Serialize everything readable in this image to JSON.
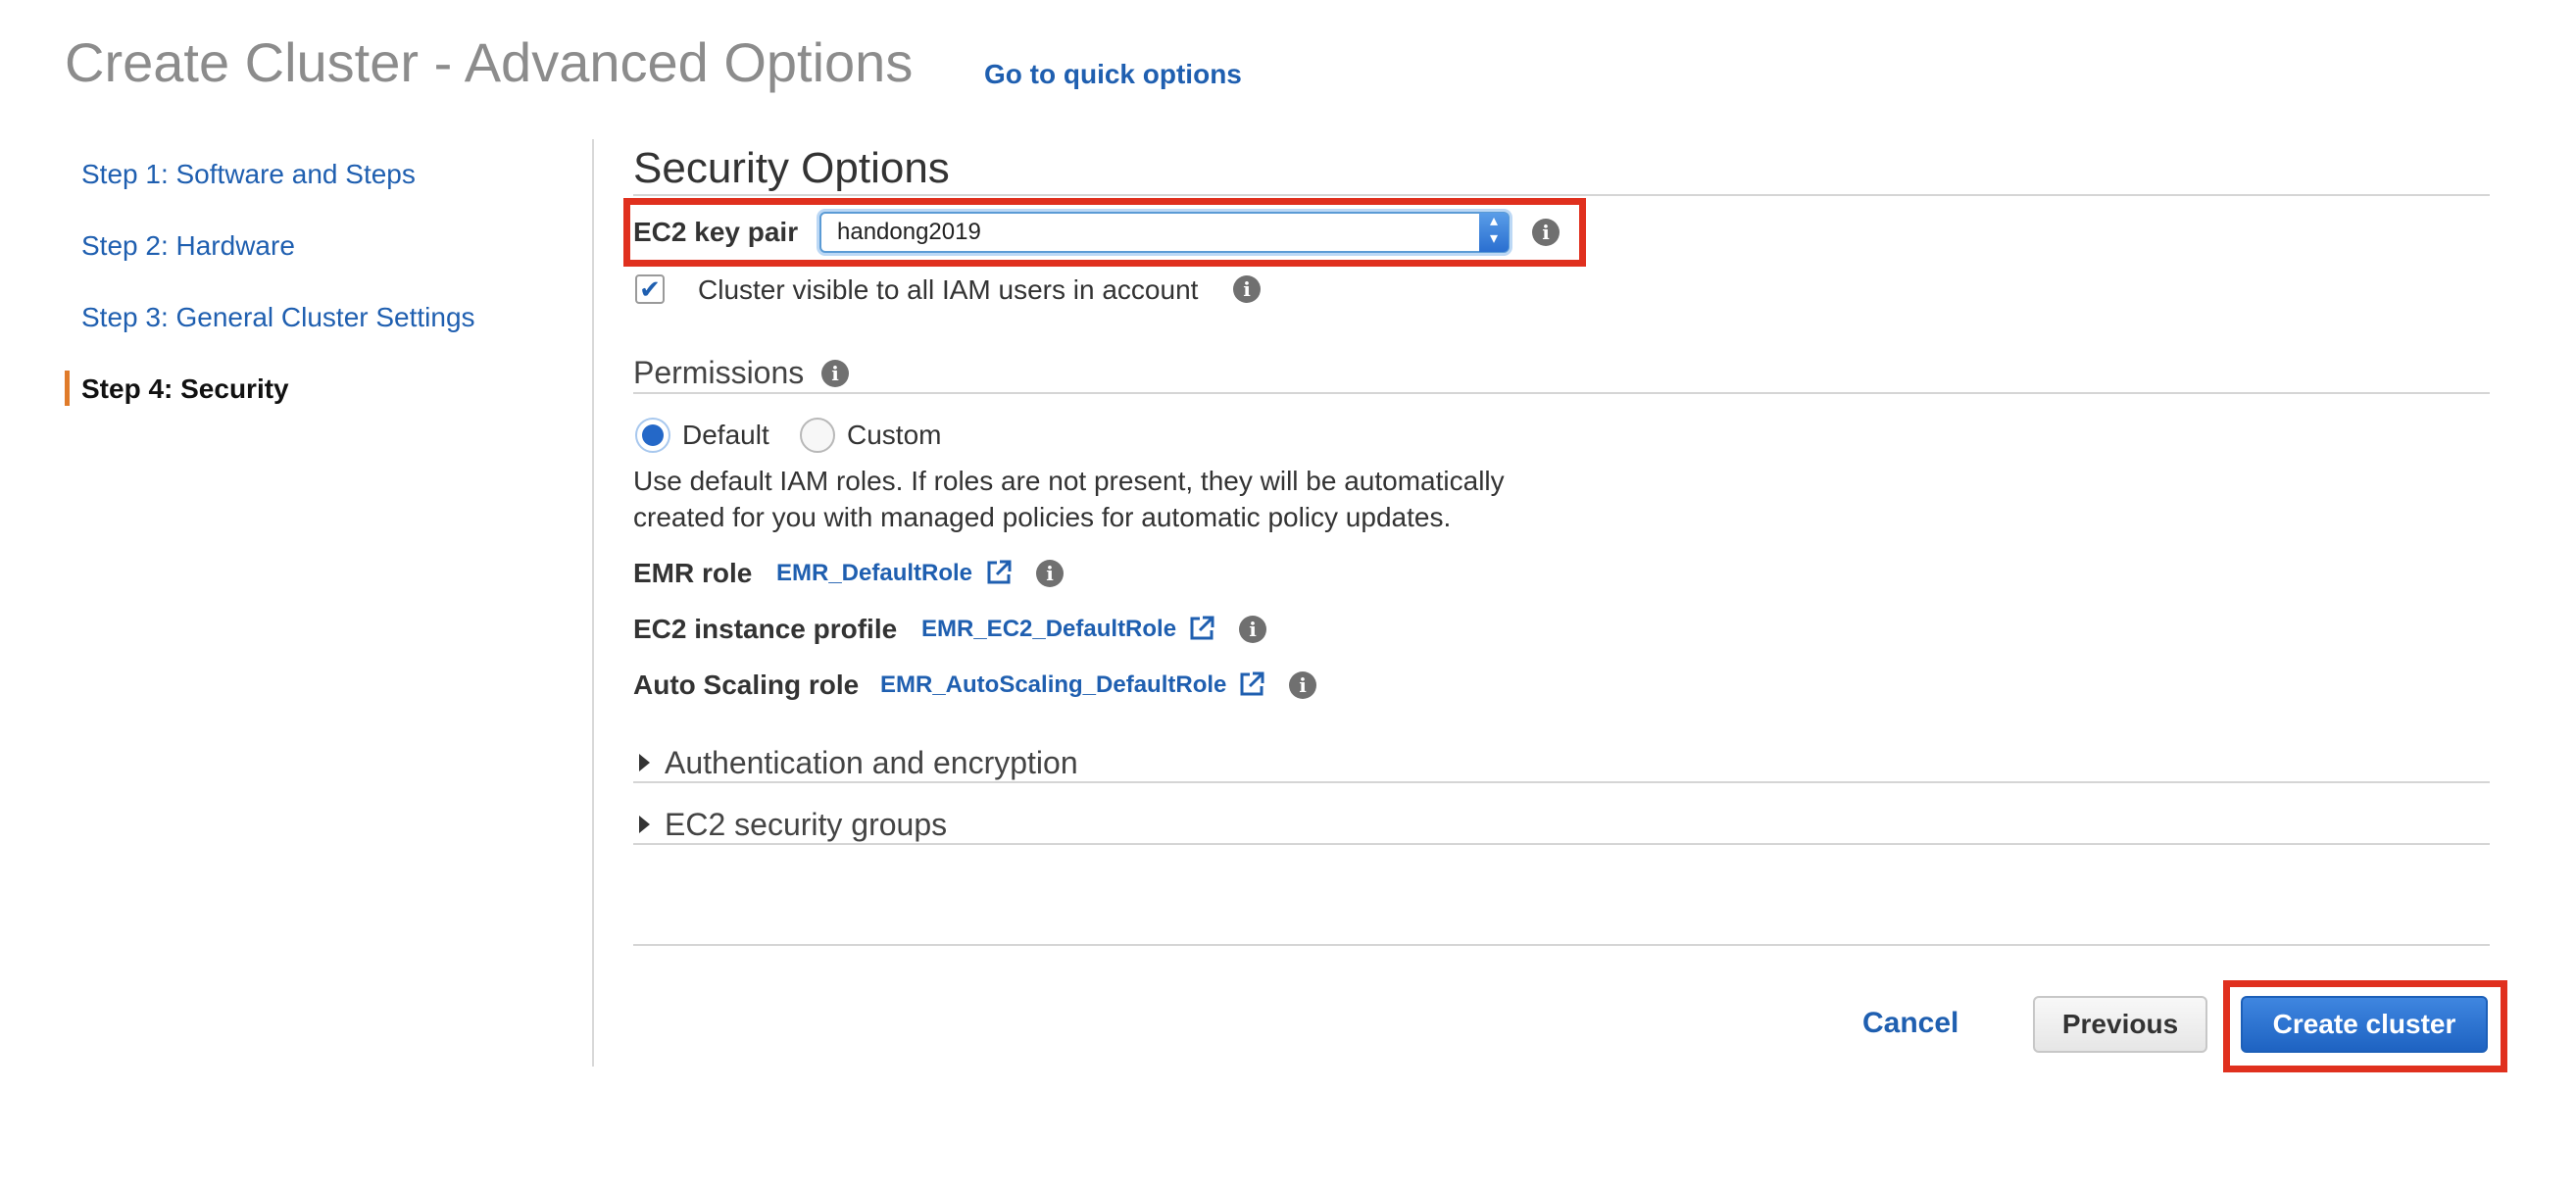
{
  "header": {
    "title": "Create Cluster - Advanced Options",
    "quick_link": "Go to quick options"
  },
  "sidebar": {
    "steps": [
      {
        "label": "Step 1: Software and Steps",
        "active": false
      },
      {
        "label": "Step 2: Hardware",
        "active": false
      },
      {
        "label": "Step 3: General Cluster Settings",
        "active": false
      },
      {
        "label": "Step 4: Security",
        "active": true
      }
    ]
  },
  "security": {
    "title": "Security Options",
    "key_pair": {
      "label": "EC2 key pair",
      "value": "handong2019"
    },
    "visibility": {
      "label": "Cluster visible to all IAM users in account",
      "checked": true
    }
  },
  "permissions": {
    "title": "Permissions",
    "options": [
      {
        "label": "Default",
        "selected": true
      },
      {
        "label": "Custom",
        "selected": false
      }
    ],
    "description_line1": "Use default IAM roles. If roles are not present, they will be automatically",
    "description_line2": "created for you with managed policies for automatic policy updates.",
    "roles": [
      {
        "label": "EMR role",
        "value": "EMR_DefaultRole"
      },
      {
        "label": "EC2 instance profile",
        "value": "EMR_EC2_DefaultRole"
      },
      {
        "label": "Auto Scaling role",
        "value": "EMR_AutoScaling_DefaultRole"
      }
    ]
  },
  "collapsibles": [
    {
      "label": "Authentication and encryption"
    },
    {
      "label": "EC2 security groups"
    }
  ],
  "footer": {
    "cancel": "Cancel",
    "previous": "Previous",
    "create": "Create cluster"
  },
  "colors": {
    "link": "#1f5fb0",
    "highlight": "#e0301e",
    "primary_button": "#1e63c2",
    "active_step_marker": "#e07b2a"
  }
}
